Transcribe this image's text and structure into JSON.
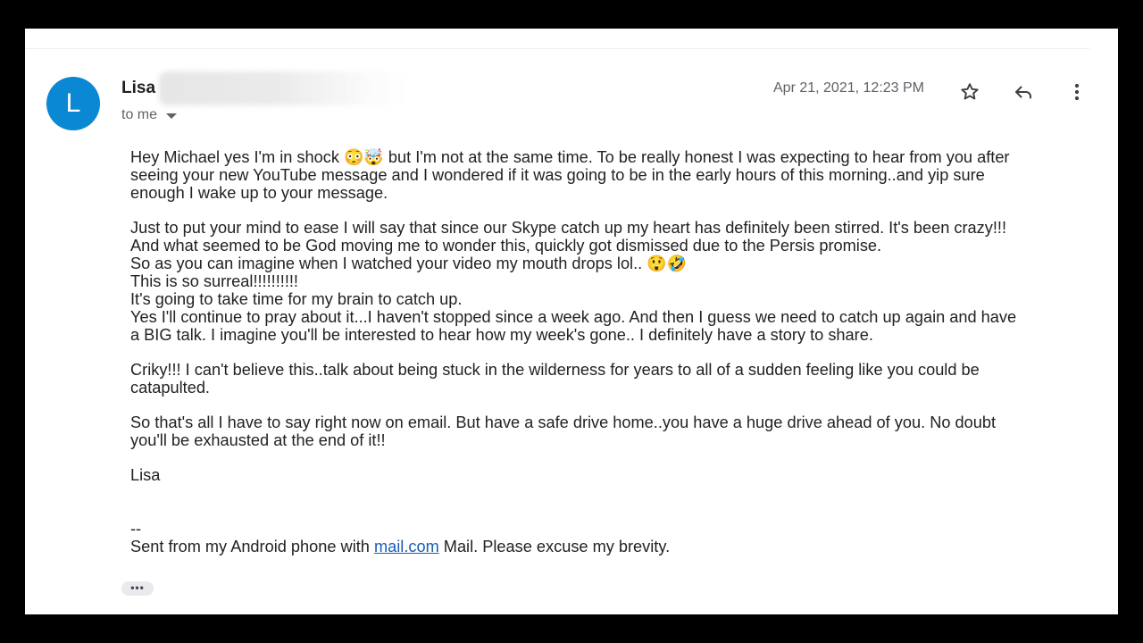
{
  "header": {
    "avatar_letter": "L",
    "avatar_color": "#0b88d4",
    "sender_name": "Lisa",
    "recipient_label": "to me",
    "date": "Apr 21, 2021, 12:23 PM",
    "actions": [
      {
        "name": "star-icon",
        "label": "Star"
      },
      {
        "name": "reply-icon",
        "label": "Reply"
      },
      {
        "name": "more-vert-icon",
        "label": "More"
      }
    ]
  },
  "body": {
    "p1": {
      "l1a": "Hey Michael yes I'm in shock ",
      "l1_emoji": "😳🤯",
      "l1b": " but I'm not at the same time. To be really honest I was expecting to hear from you after",
      "l2": "seeing your new YouTube message and I wondered if it was going to be in the early hours of this morning..and yip sure",
      "l3": "enough I wake up to your message."
    },
    "p2": {
      "l1": "Just to put your mind to ease I will say that since our Skype catch up my heart has definitely been stirred. It's been crazy!!!",
      "l2": "And what seemed to be God moving me to wonder this, quickly got dismissed due to the Persis promise.",
      "l3a": "So as you can imagine when I watched your video my mouth drops lol.. ",
      "l3_emoji": "😲🤣",
      "l4": "This is so surreal!!!!!!!!!!",
      "l5": "It's going to take time for my brain to catch up.",
      "l6": "Yes I'll continue to pray about it...I haven't stopped since a week ago. And then I guess we need to catch up again and have",
      "l7": "a BIG talk. I imagine you'll be interested to hear how my week's gone.. I definitely have a story to share."
    },
    "p3": {
      "l1": "Criky!!! I can't believe this..talk about being stuck in the wilderness for years to all of a sudden feeling like you could be",
      "l2": "catapulted."
    },
    "p4": {
      "l1": "So that's all I have to say right now on email. But have a safe drive home..you have a huge drive ahead of you. No doubt",
      "l2": "you'll be exhausted at the end of it!!"
    },
    "signoff": "Lisa",
    "signature": {
      "separator": "--",
      "prefix": "Sent from my Android phone with ",
      "link_text": "mail.com",
      "suffix": " Mail. Please excuse my brevity."
    }
  },
  "trimmed_content_button": "•••"
}
